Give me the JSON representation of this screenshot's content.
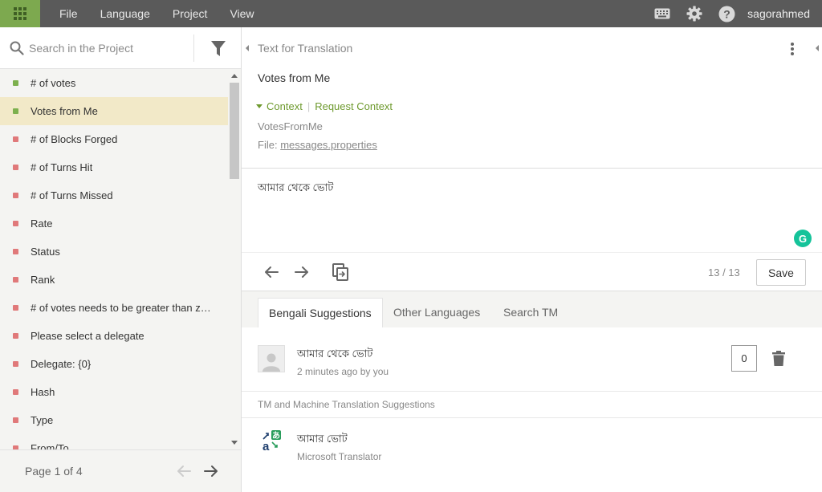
{
  "menu": {
    "file": "File",
    "language": "Language",
    "project": "Project",
    "view": "View"
  },
  "user": {
    "name": "sagorahmed"
  },
  "search": {
    "placeholder": "Search in the Project"
  },
  "strings": [
    {
      "label": "# of votes",
      "status": "green"
    },
    {
      "label": "Votes from Me",
      "status": "green",
      "selected": true
    },
    {
      "label": "# of Blocks Forged",
      "status": "red"
    },
    {
      "label": "# of Turns Hit",
      "status": "red"
    },
    {
      "label": "# of Turns Missed",
      "status": "red"
    },
    {
      "label": "Rate",
      "status": "red"
    },
    {
      "label": "Status",
      "status": "red"
    },
    {
      "label": "Rank",
      "status": "red"
    },
    {
      "label": "# of votes needs to be greater than z…",
      "status": "red"
    },
    {
      "label": "Please select a delegate",
      "status": "red"
    },
    {
      "label": "Delegate: {0}",
      "status": "red"
    },
    {
      "label": "Hash",
      "status": "red"
    },
    {
      "label": "Type",
      "status": "red"
    },
    {
      "label": "From/To",
      "status": "red"
    }
  ],
  "pager": {
    "text": "Page 1 of 4"
  },
  "source": {
    "label": "Text for Translation",
    "text": "Votes from Me",
    "context_label": "Context",
    "request_context": "Request Context",
    "key": "VotesFromMe",
    "file_prefix": "File:",
    "file_name": "messages.properties"
  },
  "translation": {
    "text": "আমার থেকে ভোট",
    "grammarly": "G"
  },
  "toolbar": {
    "counter": "13 / 13",
    "save_label": "Save"
  },
  "tabs": {
    "bengali": "Bengali Suggestions",
    "other": "Other Languages",
    "search_tm": "Search TM"
  },
  "suggestion": {
    "text": "আমার থেকে ভোট",
    "meta": "2 minutes ago by you",
    "votes": "0"
  },
  "tm": {
    "heading": "TM and Machine Translation Suggestions",
    "text": "আমার ভোট",
    "source": "Microsoft Translator"
  },
  "colors": {
    "topbar": "#5a5a5a",
    "apps": "#7da94f",
    "accent": "#6e9a2e",
    "selected": "#f2e9c8",
    "approved": "#7db04e",
    "untranslated": "#e0797a"
  }
}
